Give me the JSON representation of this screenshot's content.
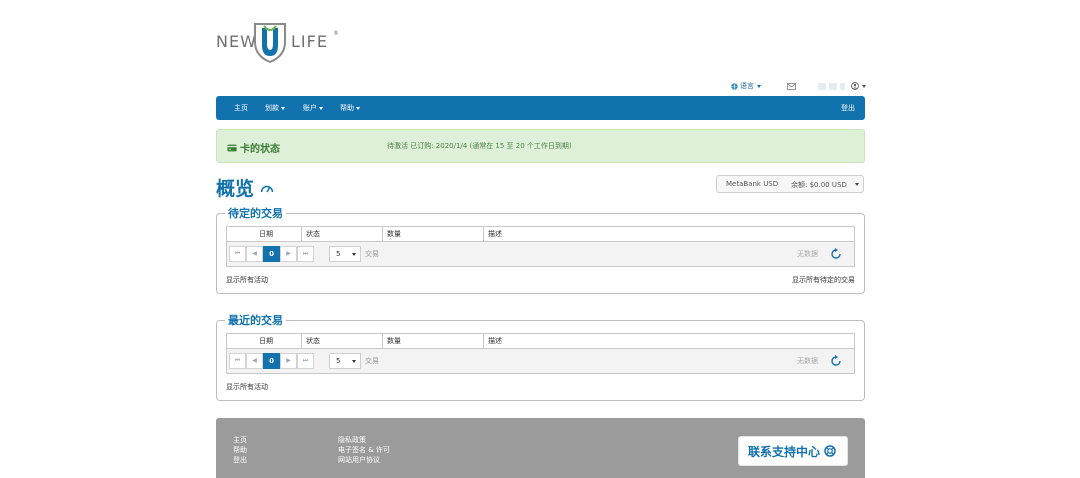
{
  "logo": {
    "new": "NEW",
    "life": "LIFE",
    "reg": "®"
  },
  "top": {
    "language": "语言"
  },
  "nav": {
    "items": [
      {
        "label": "主页",
        "has_caret": false
      },
      {
        "label": "划款",
        "has_caret": true
      },
      {
        "label": "账户",
        "has_caret": true
      },
      {
        "label": "帮助",
        "has_caret": true
      }
    ],
    "logout": "登出"
  },
  "card_status": {
    "title": "卡的状态",
    "text": "待激活 已订购: 2020/1/4 (通常在 15 至 20 个工作日到期)"
  },
  "overview": {
    "title": "概览",
    "account": "MetaBank USD",
    "balance": "余额: $0.00 USD"
  },
  "pending": {
    "title": "待定的交易",
    "columns": [
      "日期",
      "状态",
      "数量",
      "描述"
    ],
    "page": "0",
    "page_size": "5",
    "page_size_label": "交易",
    "no_data": "无数据",
    "show_all": "显示所有活动",
    "show_all_pending": "显示所有待定的交易"
  },
  "recent": {
    "title": "最近的交易",
    "columns": [
      "日期",
      "状态",
      "数量",
      "描述"
    ],
    "page": "0",
    "page_size": "5",
    "page_size_label": "交易",
    "no_data": "无数据",
    "show_all": "显示所有活动"
  },
  "footer": {
    "col1": [
      "主页",
      "帮助",
      "登出"
    ],
    "col2": [
      "隐私政策",
      "电子签名 & 许可",
      "网站用户协议"
    ],
    "support": "联系支持中心"
  },
  "colors": {
    "brand": "#1172ad",
    "alert_bg": "#dff0d8",
    "footer_bg": "#9b9b9b"
  }
}
